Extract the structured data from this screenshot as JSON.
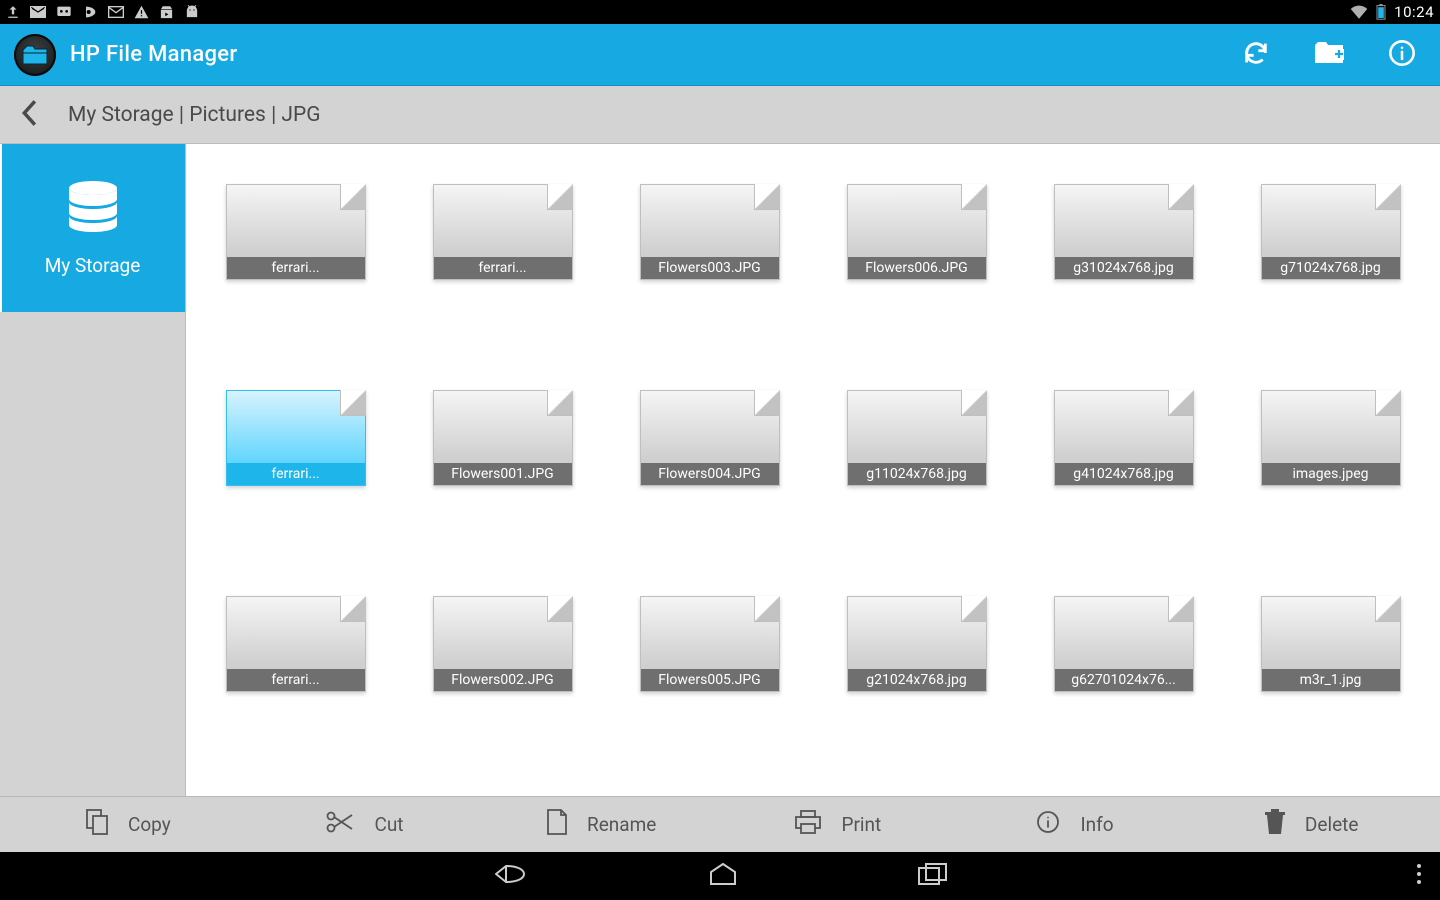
{
  "status": {
    "clock": "10:24"
  },
  "header": {
    "app_title": "HP File Manager"
  },
  "breadcrumb": {
    "path": "My Storage | Pictures | JPG"
  },
  "sidebar": {
    "storage_label": "My Storage"
  },
  "files": [
    {
      "name": "ferrari...",
      "selected": false
    },
    {
      "name": "ferrari...",
      "selected": false
    },
    {
      "name": "Flowers003.JPG",
      "selected": false
    },
    {
      "name": "Flowers006.JPG",
      "selected": false
    },
    {
      "name": "g31024x768.jpg",
      "selected": false
    },
    {
      "name": "g71024x768.jpg",
      "selected": false
    },
    {
      "name": "ferrari...",
      "selected": true
    },
    {
      "name": "Flowers001.JPG",
      "selected": false
    },
    {
      "name": "Flowers004.JPG",
      "selected": false
    },
    {
      "name": "g11024x768.jpg",
      "selected": false
    },
    {
      "name": "g41024x768.jpg",
      "selected": false
    },
    {
      "name": "images.jpeg",
      "selected": false
    },
    {
      "name": "ferrari...",
      "selected": false
    },
    {
      "name": "Flowers002.JPG",
      "selected": false
    },
    {
      "name": "Flowers005.JPG",
      "selected": false
    },
    {
      "name": "g21024x768.jpg",
      "selected": false
    },
    {
      "name": "g62701024x76...",
      "selected": false
    },
    {
      "name": "m3r_1.jpg",
      "selected": false
    }
  ],
  "toolbar": {
    "copy": "Copy",
    "cut": "Cut",
    "rename": "Rename",
    "print": "Print",
    "info": "Info",
    "delete": "Delete"
  }
}
